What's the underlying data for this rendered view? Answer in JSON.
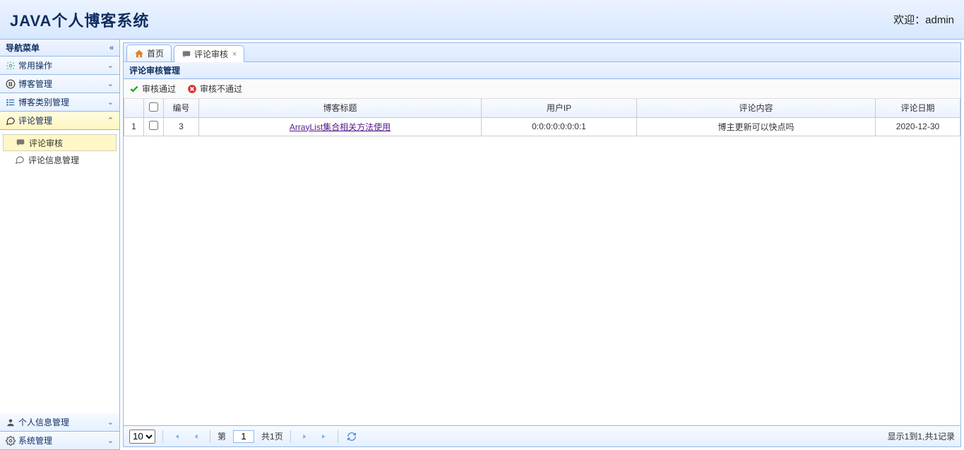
{
  "header": {
    "title": "JAVA个人博客系统",
    "welcome_prefix": "欢迎：",
    "username": "admin"
  },
  "sidebar": {
    "title": "导航菜单",
    "panels": [
      {
        "key": "common",
        "label": "常用操作",
        "expanded": false
      },
      {
        "key": "blog",
        "label": "博客管理",
        "expanded": false
      },
      {
        "key": "category",
        "label": "博客类别管理",
        "expanded": false
      },
      {
        "key": "comment",
        "label": "评论管理",
        "expanded": true,
        "items": [
          {
            "key": "review",
            "label": "评论审核",
            "icon": "chat-icon",
            "selected": true
          },
          {
            "key": "info",
            "label": "评论信息管理",
            "icon": "bubble-icon",
            "selected": false
          }
        ]
      },
      {
        "key": "profile",
        "label": "个人信息管理",
        "expanded": false
      },
      {
        "key": "system",
        "label": "系统管理",
        "expanded": false
      }
    ]
  },
  "tabs": [
    {
      "key": "home",
      "label": "首页",
      "icon": "home-icon",
      "closable": false,
      "active": false
    },
    {
      "key": "review",
      "label": "评论审核",
      "icon": "chat-icon",
      "closable": true,
      "active": true
    }
  ],
  "panel": {
    "title": "评论审核管理",
    "toolbar": {
      "approve": "审核通过",
      "reject": "审核不通过"
    },
    "columns": {
      "id": "编号",
      "title": "博客标题",
      "ip": "用户IP",
      "content": "评论内容",
      "date": "评论日期"
    },
    "rows": [
      {
        "rownum": "1",
        "id": "3",
        "title": "ArrayList集合相关方法使用",
        "ip": "0:0:0:0:0:0:0:1",
        "content": "博主更新可以快点吗",
        "date": "2020-12-30"
      }
    ]
  },
  "pager": {
    "page_size_options": [
      "10"
    ],
    "page_size": "10",
    "page_label_prefix": "第",
    "page_num": "1",
    "page_total_label": "共1页",
    "status": "显示1到1,共1记录"
  }
}
